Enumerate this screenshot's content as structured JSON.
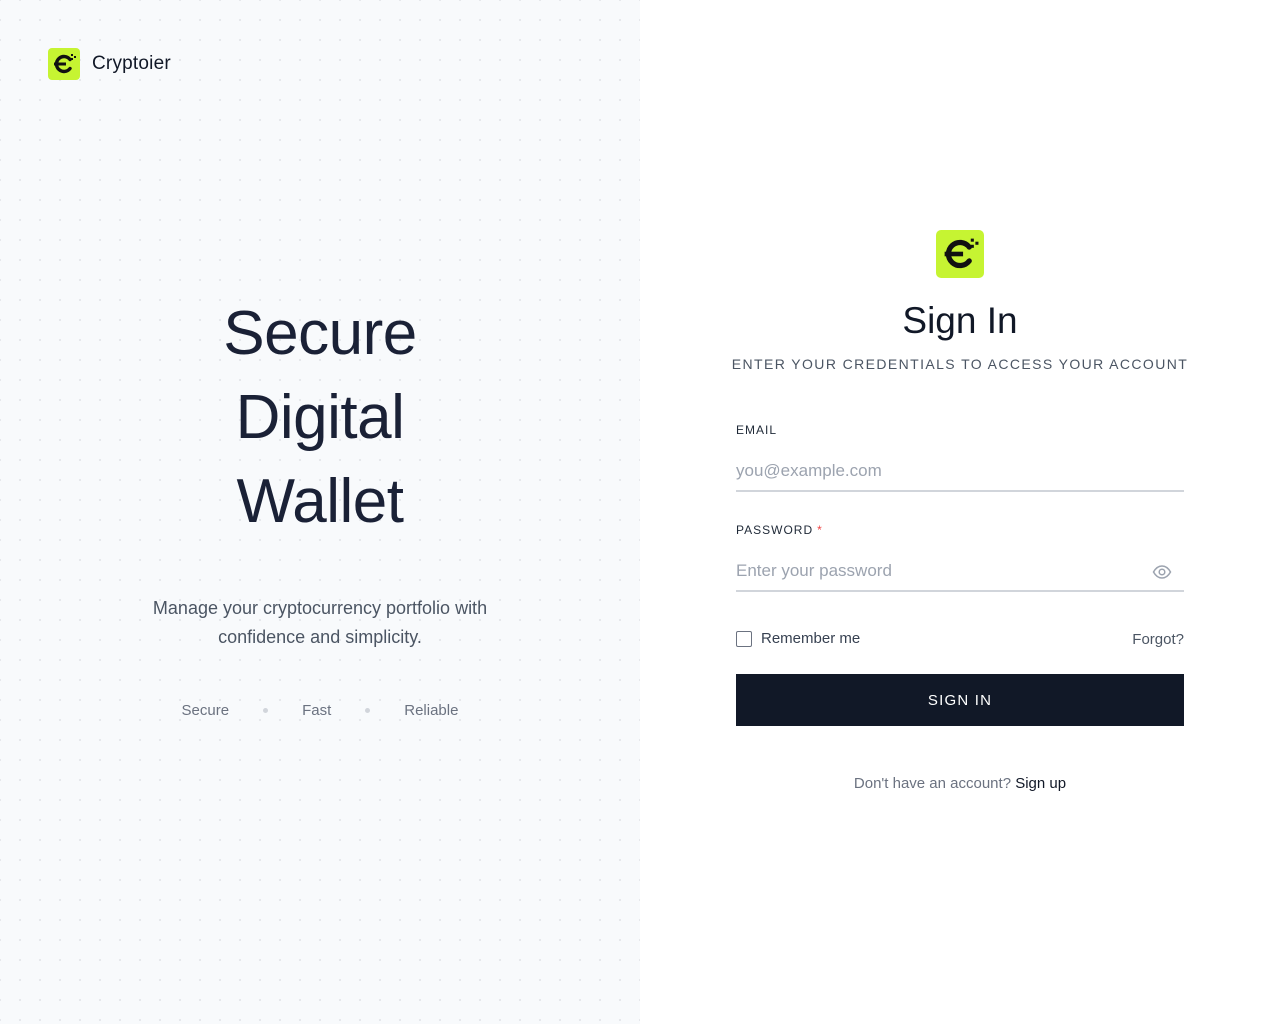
{
  "brand": {
    "name": "Cryptoier",
    "accent": "#c6f432",
    "icon": "cryptoier-logo-icon"
  },
  "hero": {
    "lines": [
      "Secure",
      "Digital",
      "Wallet"
    ],
    "subtitle": "Manage your cryptocurrency portfolio with confidence and simplicity.",
    "features": [
      "Secure",
      "Fast",
      "Reliable"
    ]
  },
  "form": {
    "title": "Sign In",
    "subtitle": "ENTER YOUR CREDENTIALS TO ACCESS YOUR ACCOUNT",
    "email_label": "EMAIL",
    "email_placeholder": "you@example.com",
    "password_label": "PASSWORD",
    "password_required_mark": "*",
    "password_placeholder": "Enter your password",
    "password_toggle_icon": "eye-icon",
    "remember_label": "Remember me",
    "remember_checked": false,
    "forgot_label": "Forgot?",
    "submit_label": "SIGN IN",
    "signup_prompt": "Don't have an account?",
    "signup_link": "Sign up",
    "button_color": "#111827"
  }
}
